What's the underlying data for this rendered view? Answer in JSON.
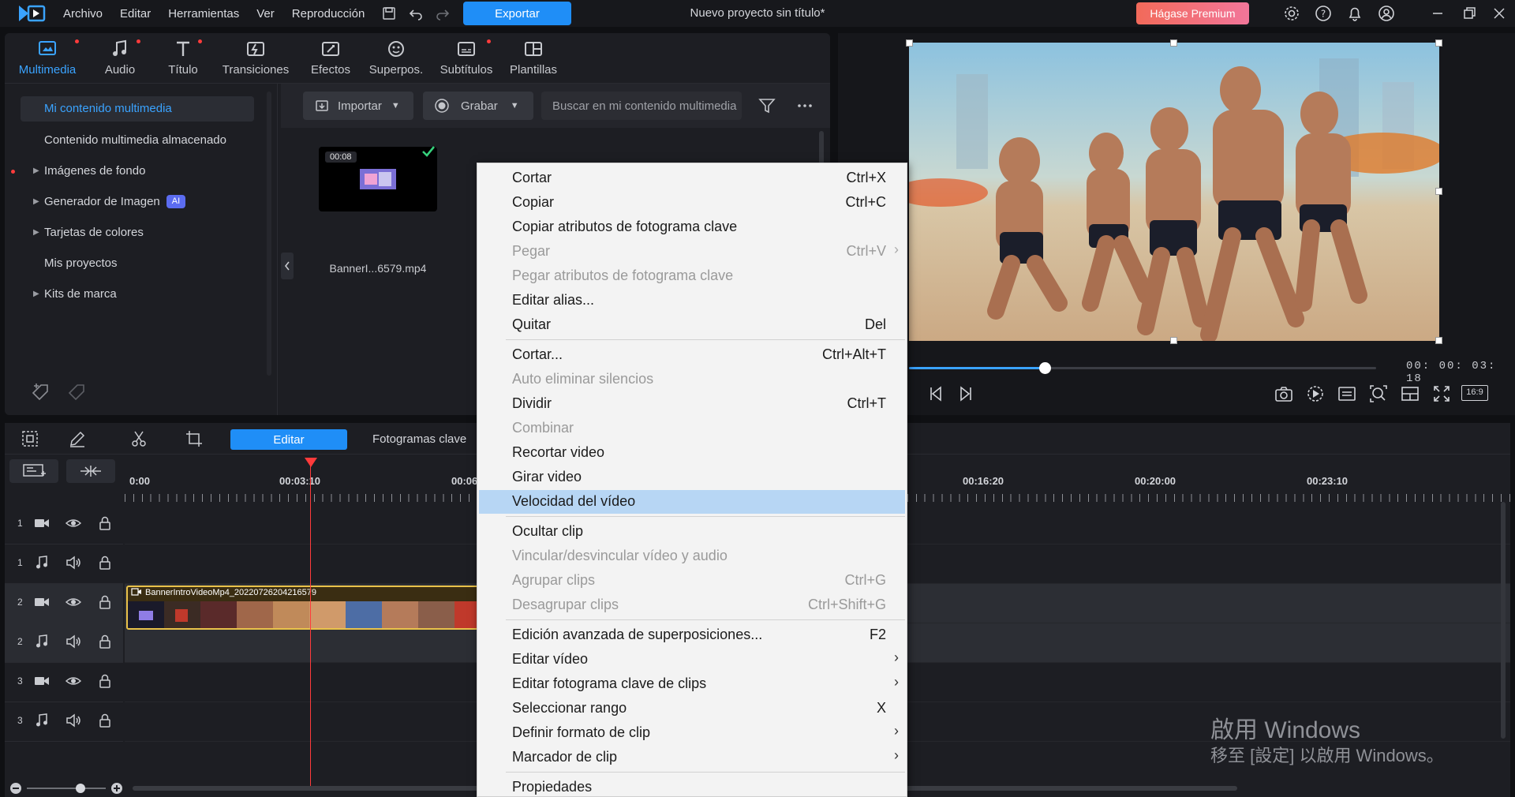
{
  "topbar": {
    "menu": [
      "Archivo",
      "Editar",
      "Herramientas",
      "Ver",
      "Reproducción"
    ],
    "export_label": "Exportar",
    "project_title": "Nuevo proyecto sin título*",
    "premium_label": "Hágase Premium"
  },
  "library": {
    "tabs": [
      {
        "label": "Multimedia",
        "icon": "media-icon"
      },
      {
        "label": "Audio",
        "icon": "music-note-icon"
      },
      {
        "label": "Título",
        "icon": "title-t-icon"
      },
      {
        "label": "Transiciones",
        "icon": "transition-icon"
      },
      {
        "label": "Efectos",
        "icon": "effects-icon"
      },
      {
        "label": "Superpos.",
        "icon": "overlay-icon"
      },
      {
        "label": "Subtítulos",
        "icon": "subtitles-icon"
      },
      {
        "label": "Plantillas",
        "icon": "templates-icon"
      }
    ],
    "sidebar": [
      {
        "label": "Mi contenido multimedia"
      },
      {
        "label": "Contenido multimedia almacenado"
      },
      {
        "label": "Imágenes de fondo"
      },
      {
        "label": "Generador de Imagen",
        "badge": "AI"
      },
      {
        "label": "Tarjetas de colores"
      },
      {
        "label": "Mis proyectos"
      },
      {
        "label": "Kits de marca"
      }
    ],
    "toolbar": {
      "import_label": "Importar",
      "record_label": "Grabar",
      "search_placeholder": "Buscar en mi contenido multimedia"
    },
    "clip": {
      "duration": "00:08",
      "name": "BannerI...6579.mp4"
    }
  },
  "preview": {
    "timecode": "00: 00: 03: 18",
    "progress": 0.29,
    "aspect": "16:9"
  },
  "timeline": {
    "edit_label": "Editar",
    "keyframes_label": "Fotogramas clave",
    "ruler": [
      "0:00",
      "00:03:10",
      "00:06",
      "00:16:20",
      "00:20:00",
      "00:23:10"
    ],
    "tracks": [
      {
        "num": "1",
        "type": "video"
      },
      {
        "num": "1",
        "type": "audio"
      },
      {
        "num": "2",
        "type": "video"
      },
      {
        "num": "2",
        "type": "audio"
      },
      {
        "num": "3",
        "type": "video"
      },
      {
        "num": "3",
        "type": "audio"
      }
    ],
    "clip_title": "BannerIntroVideoMp4_20220726204216579"
  },
  "context_menu": {
    "items": [
      {
        "label": "Cortar",
        "shortcut": "Ctrl+X"
      },
      {
        "label": "Copiar",
        "shortcut": "Ctrl+C"
      },
      {
        "label": "Copiar atributos de fotograma clave",
        "shortcut": ""
      },
      {
        "label": "Pegar",
        "shortcut": "Ctrl+V",
        "disabled": true,
        "submenu": true
      },
      {
        "label": "Pegar atributos de fotograma clave",
        "shortcut": "",
        "disabled": true
      },
      {
        "label": "Editar alias...",
        "shortcut": ""
      },
      {
        "label": "Quitar",
        "shortcut": "Del"
      },
      {
        "label": "Cortar...",
        "shortcut": "Ctrl+Alt+T"
      },
      {
        "label": "Auto eliminar silencios",
        "shortcut": "",
        "disabled": true
      },
      {
        "label": "Dividir",
        "shortcut": "Ctrl+T"
      },
      {
        "label": "Combinar",
        "shortcut": "",
        "disabled": true
      },
      {
        "label": "Recortar video",
        "shortcut": ""
      },
      {
        "label": "Girar video",
        "shortcut": ""
      },
      {
        "label": "Velocidad del vídeo",
        "shortcut": "",
        "highlighted": true
      },
      {
        "label": "Ocultar clip",
        "shortcut": ""
      },
      {
        "label": "Vincular/desvincular vídeo y audio",
        "shortcut": "",
        "disabled": true
      },
      {
        "label": "Agrupar clips",
        "shortcut": "Ctrl+G",
        "disabled": true
      },
      {
        "label": "Desagrupar clips",
        "shortcut": "Ctrl+Shift+G",
        "disabled": true
      },
      {
        "label": "Edición avanzada de superposiciones...",
        "shortcut": "F2"
      },
      {
        "label": "Editar vídeo",
        "shortcut": "",
        "submenu": true
      },
      {
        "label": "Editar fotograma clave de clips",
        "shortcut": "",
        "submenu": true
      },
      {
        "label": "Seleccionar rango",
        "shortcut": "X"
      },
      {
        "label": "Definir formato de clip",
        "shortcut": "",
        "submenu": true
      },
      {
        "label": "Marcador de clip",
        "shortcut": "",
        "submenu": true
      },
      {
        "label": "Propiedades",
        "shortcut": ""
      }
    ]
  },
  "watermark": {
    "line1": "啟用 Windows",
    "line2": "移至 [設定] 以啟用 Windows。"
  },
  "colors": {
    "accent": "#1f8ef7",
    "playhead": "#ff3b3b",
    "clip_border": "#e9c24a",
    "menu_highlight": "#b7d6f4"
  }
}
